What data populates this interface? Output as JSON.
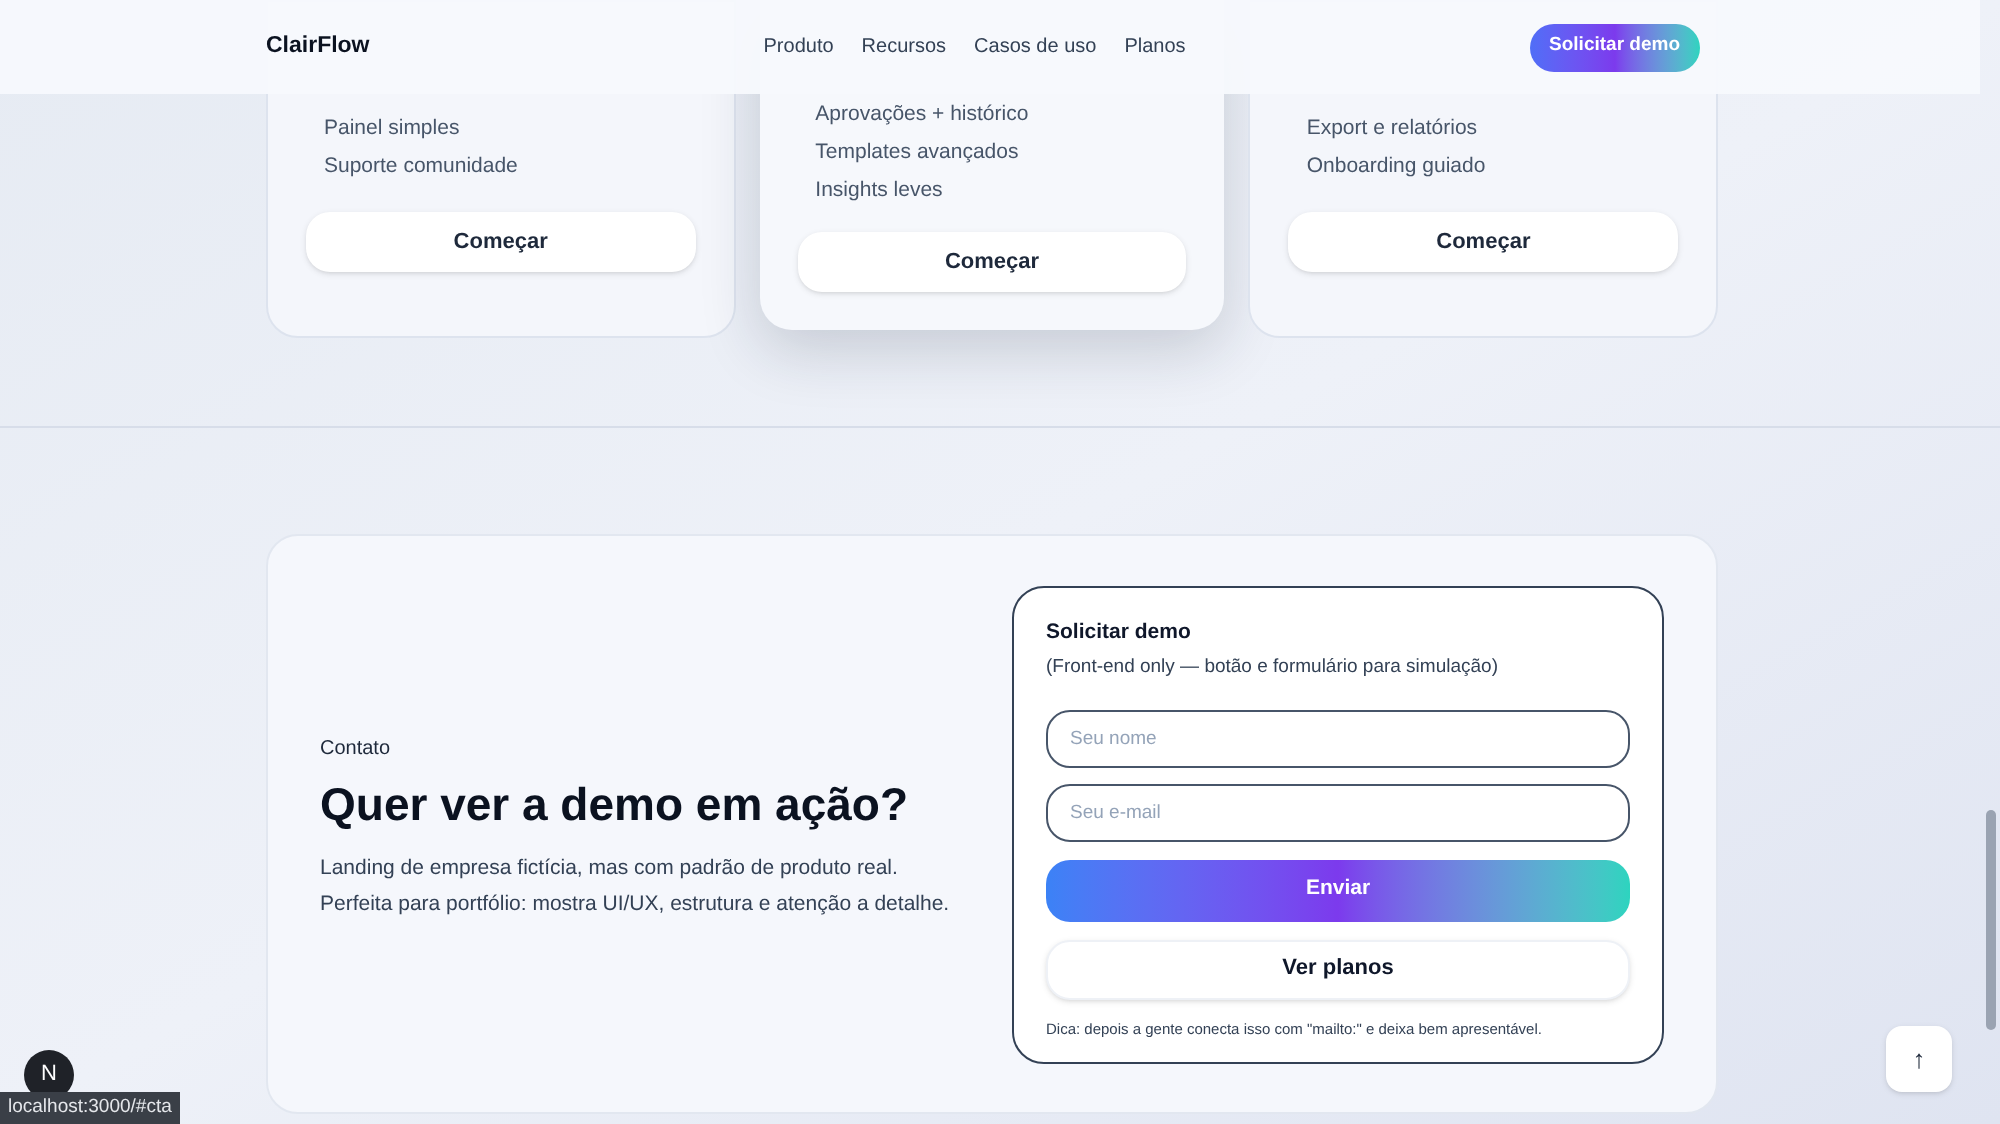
{
  "header": {
    "logo": "ClairFlow",
    "nav": [
      "Produto",
      "Recursos",
      "Casos de uso",
      "Planos"
    ],
    "cta": "Solicitar demo"
  },
  "plans": [
    {
      "features": [
        "Painel simples",
        "Suporte comunidade"
      ],
      "button": "Começar",
      "featured": false
    },
    {
      "features": [
        "Aprovações + histórico",
        "Templates avançados",
        "Insights leves"
      ],
      "button": "Começar",
      "featured": true
    },
    {
      "features": [
        "Export e relatórios",
        "Onboarding guiado"
      ],
      "button": "Começar",
      "featured": false
    }
  ],
  "contact": {
    "eyebrow": "Contato",
    "title": "Quer ver a demo em ação?",
    "text": "Landing de empresa fictícia, mas com padrão de produto real. Perfeita para portfólio: mostra UI/UX, estrutura e atenção a detalhe.",
    "form": {
      "title": "Solicitar demo",
      "subtitle": "(Front-end only — botão e formulário para simulação)",
      "fields": [
        {
          "placeholder": "Seu nome"
        },
        {
          "placeholder": "Seu e-mail"
        }
      ],
      "submit": "Enviar",
      "secondary": "Ver planos",
      "tip": "Dica: depois a gente conecta isso com \"mailto:\" e deixa bem apresentável."
    }
  },
  "dev_badge": "N",
  "status_bar": "localhost:3000/#cta",
  "back_to_top": "↑"
}
